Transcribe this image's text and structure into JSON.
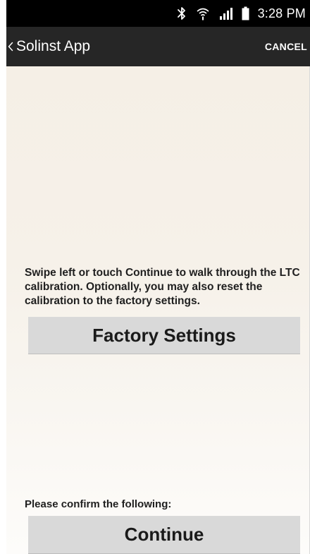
{
  "status_bar": {
    "time": "3:28 PM",
    "icons": [
      "bluetooth-icon",
      "wifi-icon",
      "signal-icon",
      "battery-icon"
    ]
  },
  "action_bar": {
    "title": "Solinst App",
    "cancel_label": "CANCEL"
  },
  "main": {
    "instructions": "Swipe left or touch Continue to walk through the LTC calibration. Optionally, you may also reset the calibration to the factory settings.",
    "factory_button_label": "Factory Settings",
    "confirm_prompt": "Please confirm the following:",
    "continue_button_label": "Continue"
  },
  "colors": {
    "status_bar_bg": "#000000",
    "action_bar_bg": "#262626",
    "content_bg": "#f6f1e9",
    "button_bg": "#d9d9d9"
  }
}
